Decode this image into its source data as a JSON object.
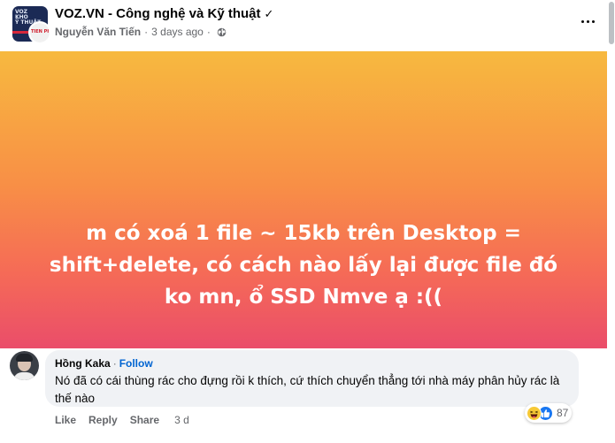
{
  "header": {
    "group_name": "VOZ.VN - Công nghệ và Kỹ thuật",
    "verified_mark": "✓",
    "group_avatar_text": "VOZ\nKHO\nỸ THUẬT",
    "author_avatar_text": "TIÊN PHÁT",
    "author_name": "Nguyễn Văn Tiến",
    "separator": "·",
    "time": "3 days ago",
    "privacy_icon": "globe-icon",
    "more_icon": "more-options-icon"
  },
  "post": {
    "background": [
      "#f7b93f",
      "#f88f46",
      "#f56a57",
      "#ea4d6a"
    ],
    "text_lines": [
      "m có xoá 1 file ~ 15kb trên Desktop =",
      "shift+delete, có cách nào lấy lại được file đó",
      "ko mn, ổ SSD Nmve ạ :(("
    ]
  },
  "comment": {
    "author": "Hồng Kaka",
    "separator": "·",
    "follow_label": "Follow",
    "text": "Nó đã có cái thùng rác cho đựng rồi k thích, cứ thích chuyển thẳng tới nhà máy phân hủy rác là thế nào",
    "actions": {
      "like": "Like",
      "reply": "Reply",
      "share": "Share",
      "time": "3 d"
    },
    "reactions": {
      "icons": [
        "haha-icon",
        "like-icon"
      ],
      "count": "87"
    }
  },
  "colors": {
    "link": "#0064d1",
    "secondary_text": "#65676b",
    "bubble": "#f0f2f5"
  }
}
